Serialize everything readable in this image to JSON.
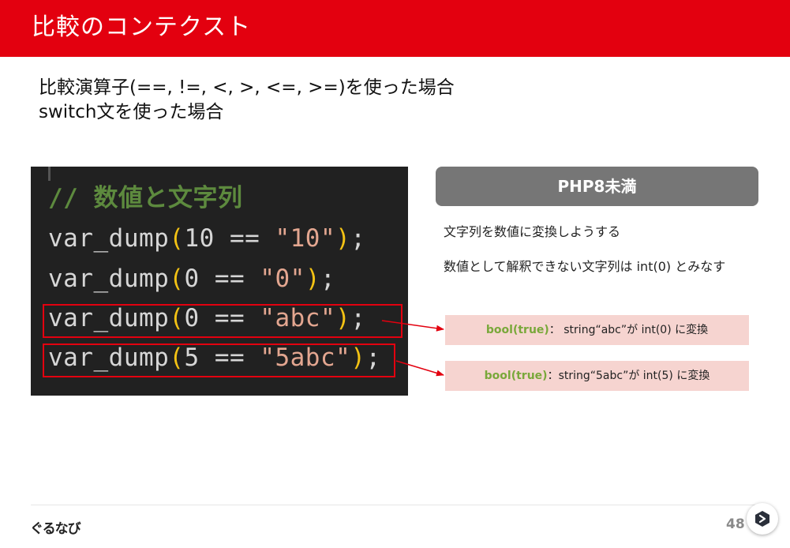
{
  "header": {
    "title": "比較のコンテクスト"
  },
  "bullets": [
    "比較演算子(==, !=, <, >, <=, >=)を使った場合",
    "switch文を使った場合"
  ],
  "code": {
    "comment": "// 数値と文字列",
    "lines": [
      {
        "fn": "var_dump",
        "num": "10",
        "op": " == ",
        "str": "\"10\""
      },
      {
        "fn": "var_dump",
        "num": "0",
        "op": " == ",
        "str": "\"0\""
      },
      {
        "fn": "var_dump",
        "num": "0",
        "op": " == ",
        "str": "\"abc\""
      },
      {
        "fn": "var_dump",
        "num": "5",
        "op": " == ",
        "str": "\"5abc\""
      }
    ],
    "open_paren": "(",
    "close_paren": ")",
    "semicolon": ";"
  },
  "panel": {
    "title": "PHP8未満",
    "note1": "文字列を数値に変換しようする",
    "note2": "数値として解釈できない文字列は int(0) とみなす"
  },
  "results": [
    {
      "bool": "bool(true)",
      "text": "：  string“abc”が int(0) に変換"
    },
    {
      "bool": "bool(true)",
      "text": "：string“5abc”が int(5) に変換"
    }
  ],
  "footer": {
    "logo": "ぐるなび",
    "page_number": "48"
  },
  "colors": {
    "accent": "#e3000f",
    "code_bg": "#212121",
    "result_bg": "#f6d4d0",
    "bool_green": "#79a83a"
  },
  "icons": {
    "help": "chevron-badge-icon"
  }
}
